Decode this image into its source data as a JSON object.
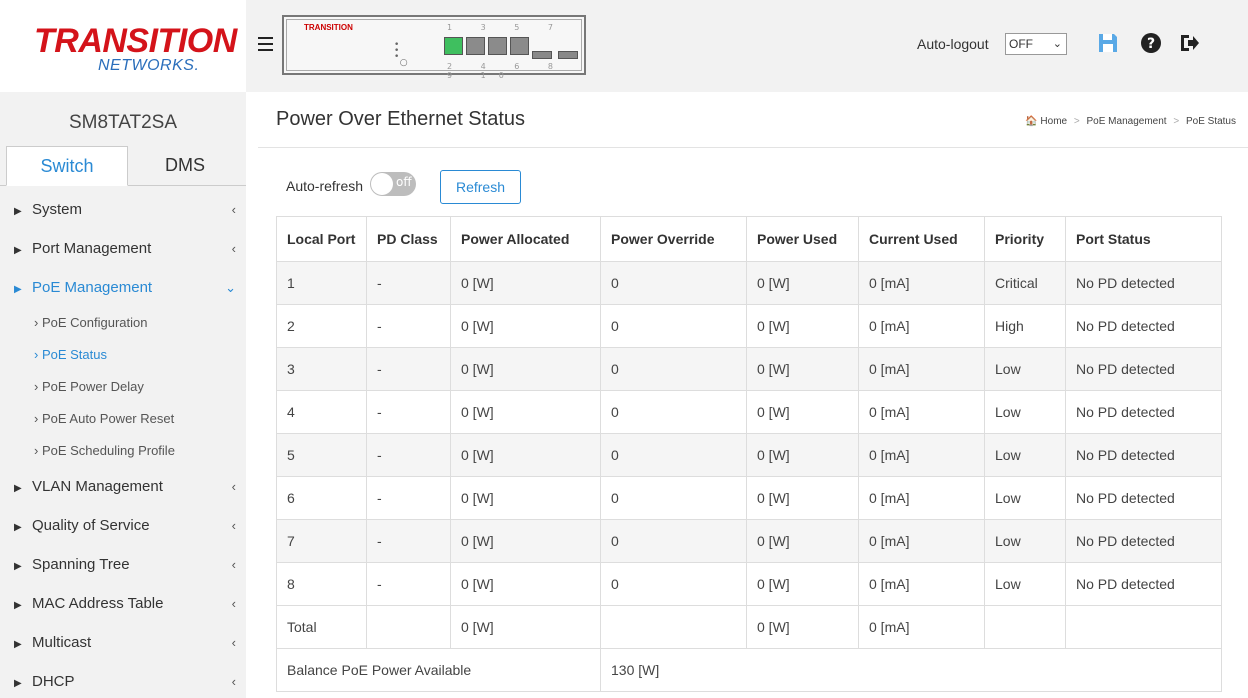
{
  "header": {
    "logo_line1": "TRANSITION",
    "logo_line2": "NETWORKS.",
    "device_brand": "TRANSITION",
    "port_numbers_top": "1 3 5 7",
    "port_numbers_bottom": "2 4 6 8 9 10",
    "autologout_label": "Auto-logout",
    "autologout_value": "OFF",
    "icons": [
      "save-icon",
      "help-icon",
      "logout-icon"
    ],
    "accent_color": "#2a8ad4"
  },
  "sidebar": {
    "model": "SM8TAT2SA",
    "tabs": [
      {
        "label": "Switch"
      },
      {
        "label": "DMS"
      }
    ],
    "items": [
      {
        "label": "System"
      },
      {
        "label": "Port Management"
      },
      {
        "label": "PoE Management"
      },
      {
        "label": "VLAN Management"
      },
      {
        "label": "Quality of Service"
      },
      {
        "label": "Spanning Tree"
      },
      {
        "label": "MAC Address Table"
      },
      {
        "label": "Multicast"
      },
      {
        "label": "DHCP"
      }
    ],
    "poe_subitems": [
      {
        "label": "PoE Configuration"
      },
      {
        "label": "PoE Status"
      },
      {
        "label": "PoE Power Delay"
      },
      {
        "label": "PoE Auto Power Reset"
      },
      {
        "label": "PoE Scheduling Profile"
      }
    ]
  },
  "main": {
    "title": "Power Over Ethernet Status",
    "breadcrumb": [
      "Home",
      "PoE Management",
      "PoE Status"
    ],
    "autorefresh_label": "Auto-refresh",
    "toggle_state": "off",
    "refresh_label": "Refresh",
    "table": {
      "headers": [
        "Local Port",
        "PD Class",
        "Power Allocated",
        "Power Override",
        "Power Used",
        "Current Used",
        "Priority",
        "Port Status"
      ],
      "rows": [
        [
          "1",
          "-",
          "0 [W]",
          "0",
          "0 [W]",
          "0 [mA]",
          "Critical",
          "No PD detected"
        ],
        [
          "2",
          "-",
          "0 [W]",
          "0",
          "0 [W]",
          "0 [mA]",
          "High",
          "No PD detected"
        ],
        [
          "3",
          "-",
          "0 [W]",
          "0",
          "0 [W]",
          "0 [mA]",
          "Low",
          "No PD detected"
        ],
        [
          "4",
          "-",
          "0 [W]",
          "0",
          "0 [W]",
          "0 [mA]",
          "Low",
          "No PD detected"
        ],
        [
          "5",
          "-",
          "0 [W]",
          "0",
          "0 [W]",
          "0 [mA]",
          "Low",
          "No PD detected"
        ],
        [
          "6",
          "-",
          "0 [W]",
          "0",
          "0 [W]",
          "0 [mA]",
          "Low",
          "No PD detected"
        ],
        [
          "7",
          "-",
          "0 [W]",
          "0",
          "0 [W]",
          "0 [mA]",
          "Low",
          "No PD detected"
        ],
        [
          "8",
          "-",
          "0 [W]",
          "0",
          "0 [W]",
          "0 [mA]",
          "Low",
          "No PD detected"
        ]
      ],
      "total": {
        "label": "Total",
        "power_allocated": "0 [W]",
        "power_used": "0 [W]",
        "current_used": "0 [mA]"
      },
      "balance": {
        "label": "Balance PoE Power Available",
        "value": "130 [W]"
      }
    }
  }
}
